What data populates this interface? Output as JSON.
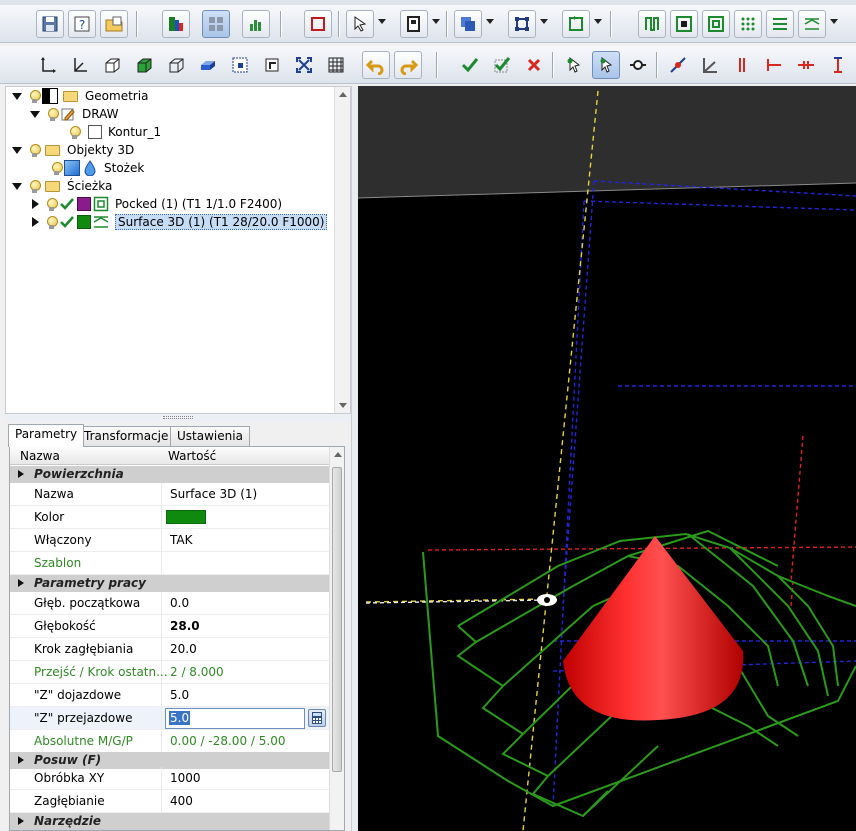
{
  "tree": {
    "items": [
      {
        "label": "Geometria"
      },
      {
        "label": "DRAW"
      },
      {
        "label": "Kontur_1"
      },
      {
        "label": "Objekty 3D"
      },
      {
        "label": "Stożek"
      },
      {
        "label": "Ścieżka"
      },
      {
        "label": "Pocked (1) (T1 1/1.0 F2400)"
      },
      {
        "label": "Surface 3D (1) (T1 28/20.0 F1000)"
      }
    ]
  },
  "tabs": [
    {
      "label": "Parametry"
    },
    {
      "label": "Transformacje"
    },
    {
      "label": "Ustawienia"
    }
  ],
  "grid": {
    "col_name": "Nazwa",
    "col_value": "Wartość",
    "cat1": "Powierzchnia",
    "nazwa_k": "Nazwa",
    "nazwa_v": "Surface 3D (1)",
    "kolor_k": "Kolor",
    "wlaczony_k": "Włączony",
    "wlaczony_v": "TAK",
    "szablon_k": "Szablon",
    "cat2": "Parametry pracy",
    "glebp_k": "Głęb. początkowa",
    "glebp_v": "0.0",
    "gleb_k": "Głębokość",
    "gleb_v": "28.0",
    "krok_k": "Krok zagłębiania",
    "krok_v": "20.0",
    "przejsc_k": "Przejść / Krok ostatn...",
    "przejsc_v": "2 / 8.000",
    "zdoj_k": "\"Z\" dojazdowe",
    "zdoj_v": "5.0",
    "zprz_k": "\"Z\" przejazdowe",
    "zprz_v": "5.0",
    "abs_k": "Absolutne M/G/P",
    "abs_v": "0.00 / -28.00 / 5.00",
    "cat3": "Posuw (F)",
    "obrobka_k": "Obróbka XY",
    "obrobka_v": "1000",
    "zagl_k": "Zagłębianie",
    "zagl_v": "400",
    "cat4": "Narzędzie"
  },
  "colors": {
    "swatch": "#0f8a0f",
    "toolpath": "#2a9a1a",
    "cone": "#ff2020"
  }
}
